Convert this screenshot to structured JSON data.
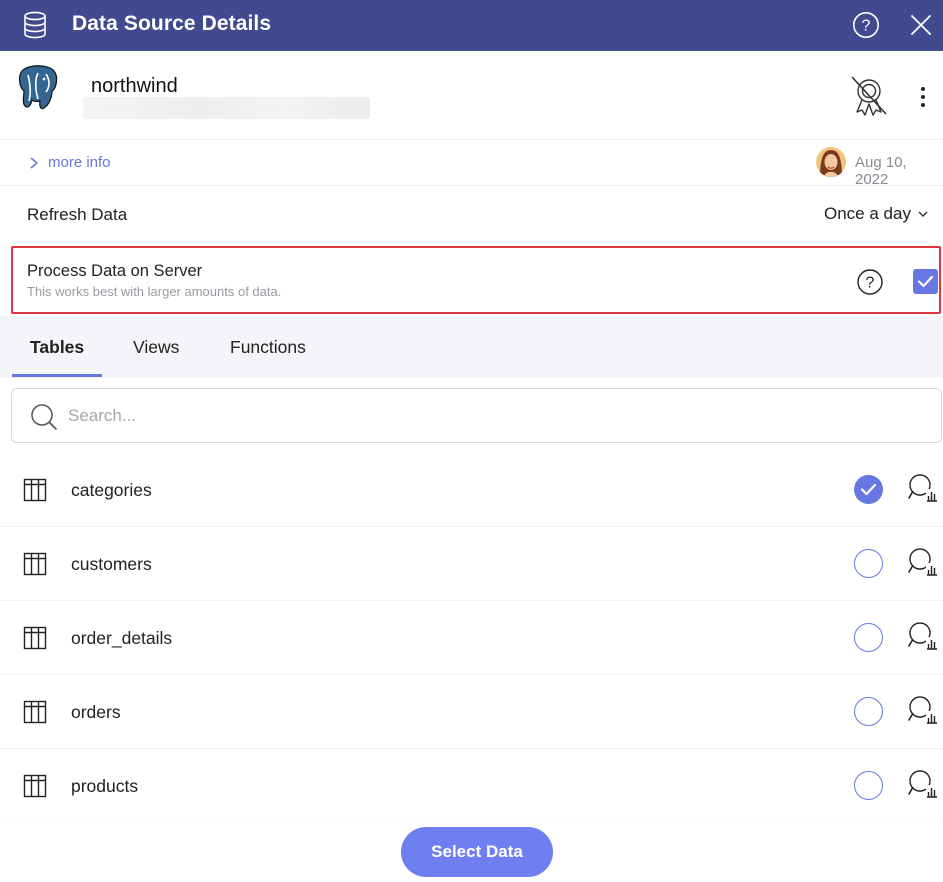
{
  "window": {
    "title": "Data Source Details"
  },
  "datasource": {
    "name": "northwind",
    "logo_icon": "postgresql-elephant-icon"
  },
  "info": {
    "more_info_label": "more info",
    "date": "Aug 10, 2022"
  },
  "refresh": {
    "label": "Refresh Data",
    "value": "Once a day"
  },
  "process_server": {
    "title": "Process Data on Server",
    "subtitle": "This works best with larger amounts of data.",
    "checked": true
  },
  "tabs": [
    {
      "label": "Tables",
      "active": true
    },
    {
      "label": "Views",
      "active": false
    },
    {
      "label": "Functions",
      "active": false
    }
  ],
  "search": {
    "placeholder": "Search...",
    "value": ""
  },
  "tables": [
    {
      "name": "categories",
      "selected": true
    },
    {
      "name": "customers",
      "selected": false
    },
    {
      "name": "order_details",
      "selected": false
    },
    {
      "name": "orders",
      "selected": false
    },
    {
      "name": "products",
      "selected": false
    }
  ],
  "footer": {
    "select_label": "Select Data"
  },
  "colors": {
    "titlebar": "#414a8f",
    "accent": "#6878e3",
    "highlight_border": "#e0363d"
  }
}
